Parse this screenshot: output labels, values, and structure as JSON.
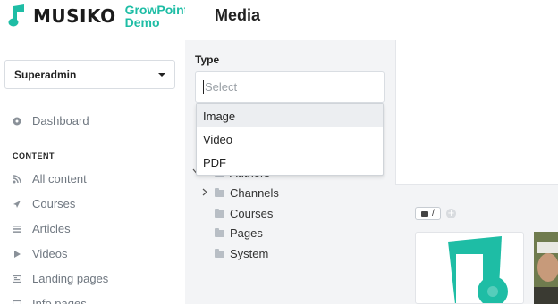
{
  "app": {
    "logo_text": "MUSIKO",
    "logo_sub_line1": "GrowPoint",
    "logo_sub_line2": "Demo",
    "accent_color": "#1ebda5"
  },
  "role_selector": {
    "value": "Superadmin"
  },
  "sidebar": {
    "dashboard": {
      "label": "Dashboard",
      "icon": "dashboard-icon"
    },
    "section_title": "CONTENT",
    "items": [
      {
        "label": "All content",
        "icon": "rss-icon"
      },
      {
        "label": "Courses",
        "icon": "rocket-icon"
      },
      {
        "label": "Articles",
        "icon": "lines-icon"
      },
      {
        "label": "Videos",
        "icon": "play-icon"
      },
      {
        "label": "Landing pages",
        "icon": "layout-icon"
      },
      {
        "label": "Info pages",
        "icon": "info-icon"
      }
    ]
  },
  "header": {
    "title": "Media"
  },
  "filter": {
    "type_label": "Type",
    "placeholder": "Select",
    "options": [
      "Image",
      "Video",
      "PDF"
    ],
    "highlighted_option": "Image"
  },
  "tree": {
    "partial_item": "Authors",
    "items": [
      "Channels",
      "Courses",
      "Pages",
      "System"
    ]
  },
  "breadcrumb": {
    "path": "/"
  }
}
